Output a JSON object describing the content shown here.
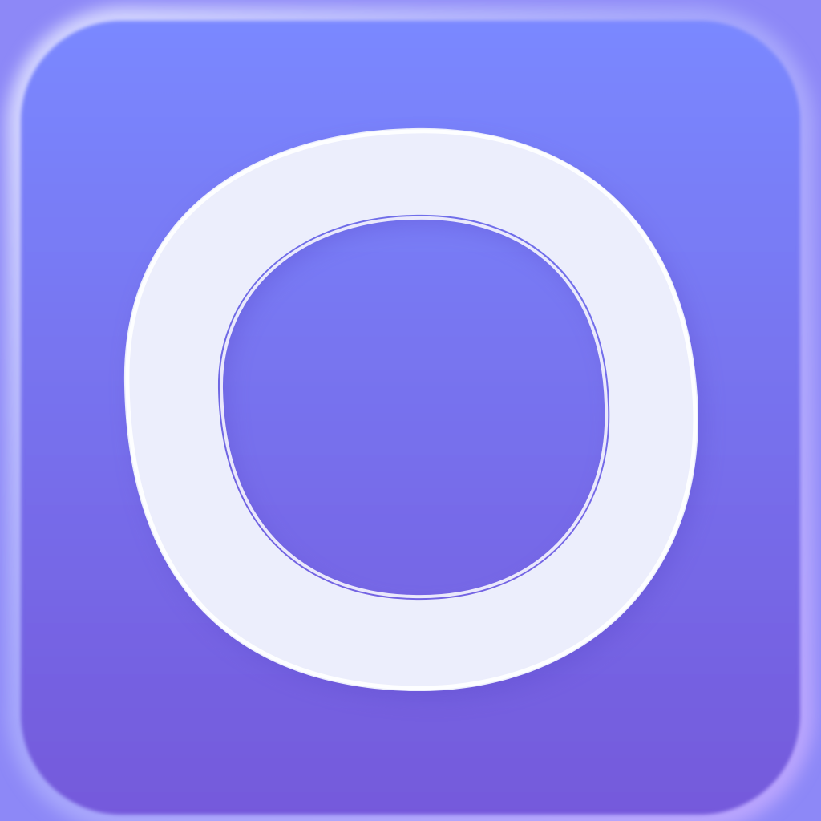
{
  "icon": {
    "name": "ring-logo-icon",
    "colors": {
      "background_top": "#7b8bff",
      "background_bottom": "#7558d9",
      "rim_light": "#c6cbff",
      "rim_bottom": "#a27cf0",
      "ring_fill": "#eceefc",
      "ring_highlight": "#ffffff",
      "ring_shadow": "#5f4fd0"
    }
  }
}
